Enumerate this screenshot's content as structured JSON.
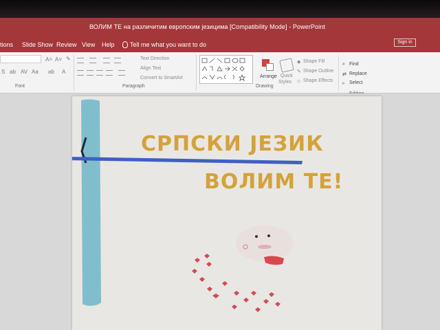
{
  "window": {
    "title": "ВОЛИМ ТЕ на различитим европским језицима [Compatibility Mode] - PowerPoint",
    "sign_in": "Sign in"
  },
  "menu": {
    "partial_first": "tions",
    "items": [
      "Slide Show",
      "Review",
      "View",
      "Help"
    ],
    "tell_me": "Tell me what you want to do"
  },
  "ribbon": {
    "font_label": "Font",
    "paragraph_label": "Paragraph",
    "drawing_label": "Drawing",
    "editing_label": "Editing",
    "text_direction": "Text Direction",
    "align_text": "Align Text",
    "convert_smartart": "Convert to SmartArt",
    "arrange": "Arrange",
    "quick_styles_1": "Quick",
    "quick_styles_2": "Styles",
    "shape_fill": "Shape Fill",
    "shape_outline": "Shape Outline",
    "shape_effects": "Shape Effects",
    "find": "Find",
    "replace": "Replace",
    "select": "Select"
  },
  "slide": {
    "title_line1": "СРПСКИ ЈЕЗИК",
    "title_line2": "ВОЛИМ ТЕ!"
  },
  "colors": {
    "accent": "#a4373a",
    "title_text": "#d4a23c",
    "slide_bg": "#e9e7e3",
    "ribbon_bg": "#f3f3f3",
    "blue_bar": "#6fb6c9",
    "blue_line": "#3f5fc4",
    "hearts": "#d04b54"
  },
  "icons": [
    "lightbulb-icon",
    "find-icon",
    "replace-icon",
    "select-icon",
    "shape-fill-icon",
    "shape-outline-icon",
    "shape-effects-icon",
    "arrange-icon",
    "quick-styles-icon"
  ]
}
